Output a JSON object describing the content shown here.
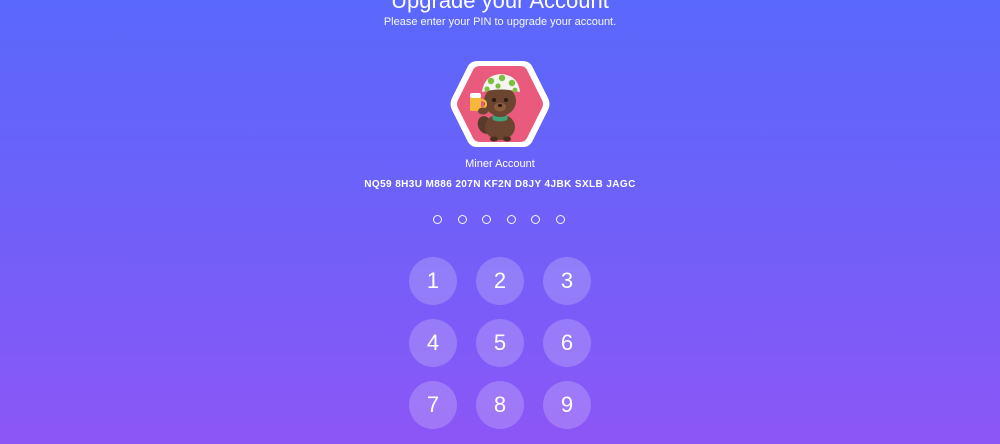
{
  "header": {
    "title": "Upgrade your Account",
    "subtitle": "Please enter your PIN to upgrade your account."
  },
  "account": {
    "avatar_icon": "beaver-hexagon-avatar",
    "label": "Miner Account",
    "address": "NQ59 8H3U M886 207N KF2N D8JY 4JBK SXLB JAGC"
  },
  "pin": {
    "length": 6,
    "entered": 0
  },
  "keypad": {
    "keys": [
      "1",
      "2",
      "3",
      "4",
      "5",
      "6",
      "7",
      "8",
      "9"
    ]
  },
  "colors": {
    "background_top": "#5a68fb",
    "background_bottom": "#8c56f6",
    "avatar_bg": "#ea5a7c"
  }
}
